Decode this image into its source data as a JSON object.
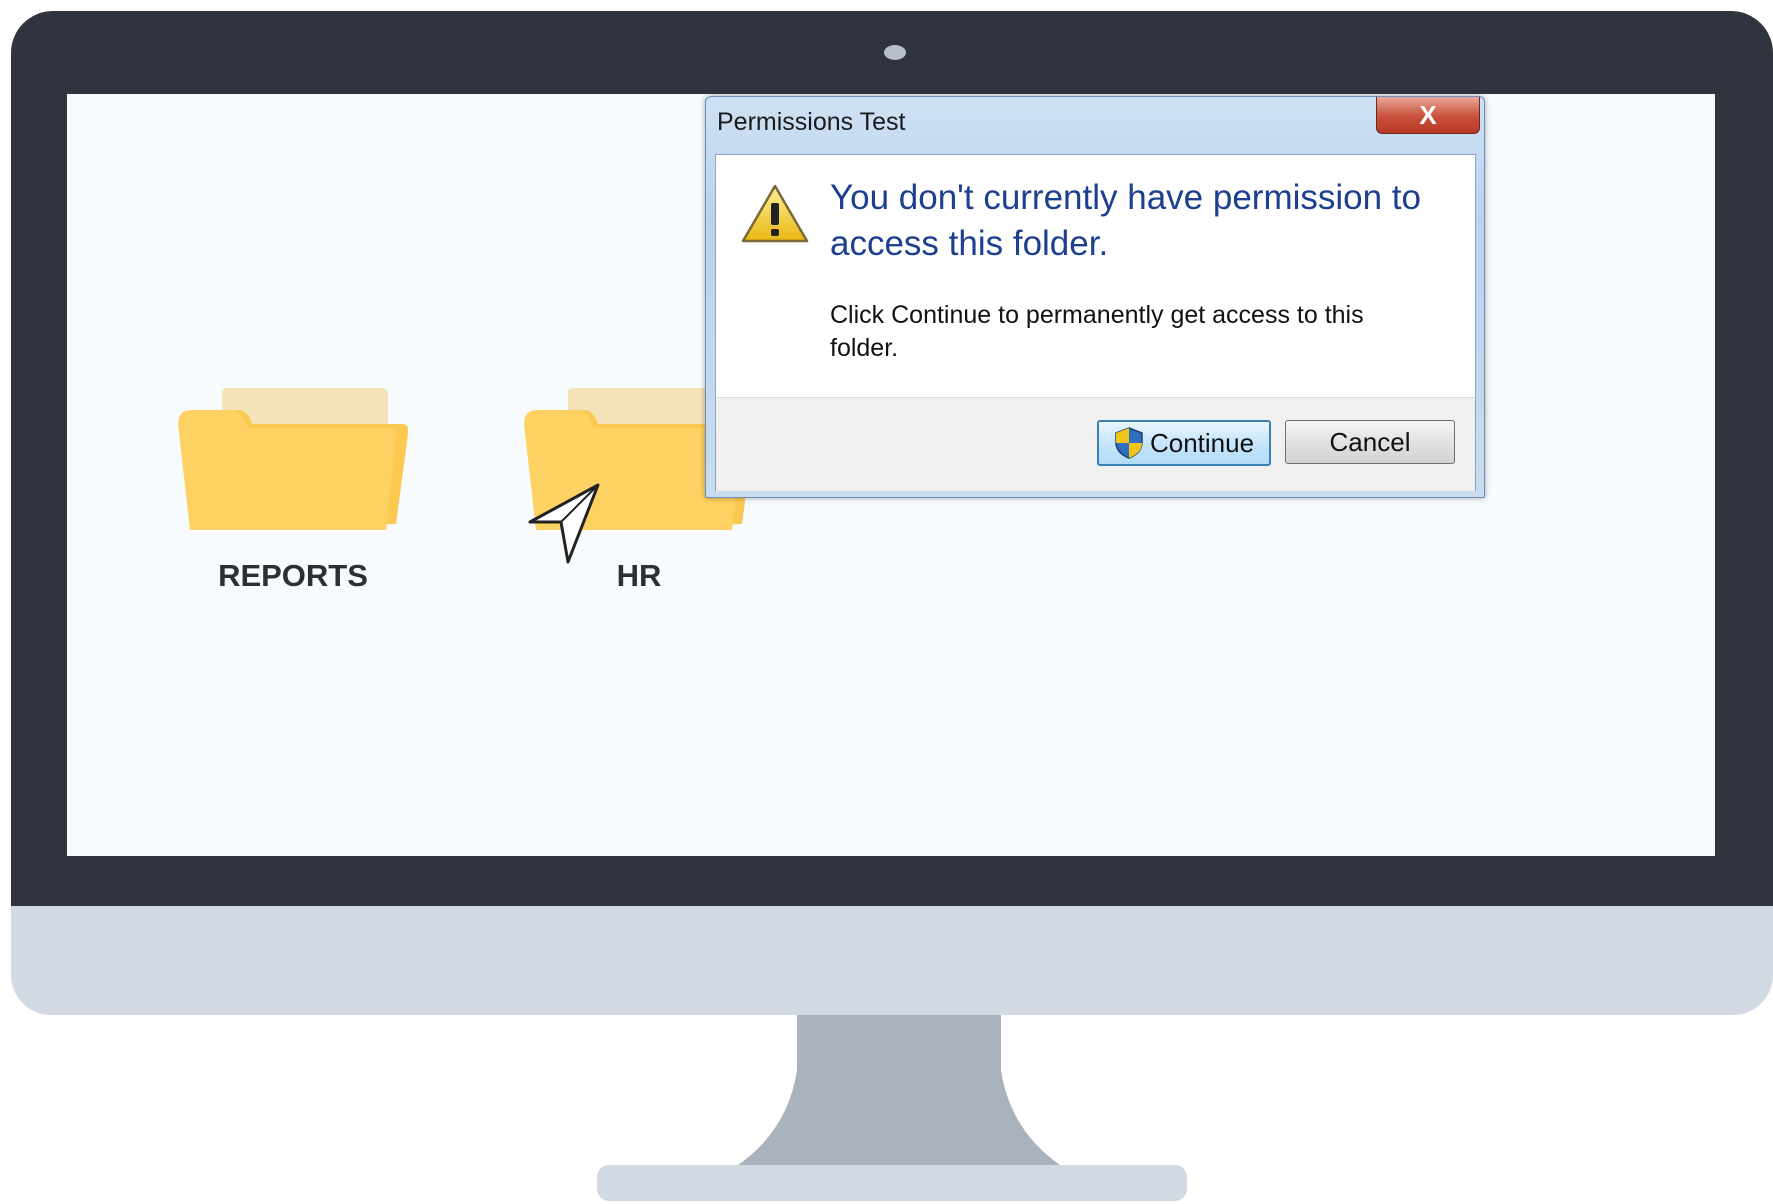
{
  "desktop": {
    "folders": [
      {
        "label": "REPORTS"
      },
      {
        "label": "HR"
      }
    ]
  },
  "dialog": {
    "title": "Permissions Test",
    "close_label": "X",
    "headline": "You don't currently have permission to access this folder.",
    "message": "Click Continue to permanently get access to this folder.",
    "buttons": {
      "continue": "Continue",
      "cancel": "Cancel"
    },
    "icon": "warning-icon"
  },
  "colors": {
    "monitor_frame": "#2f343e",
    "screen": "#f7fbfd",
    "folder_body": "#fdd262",
    "headline_text": "#1d3f8f"
  }
}
